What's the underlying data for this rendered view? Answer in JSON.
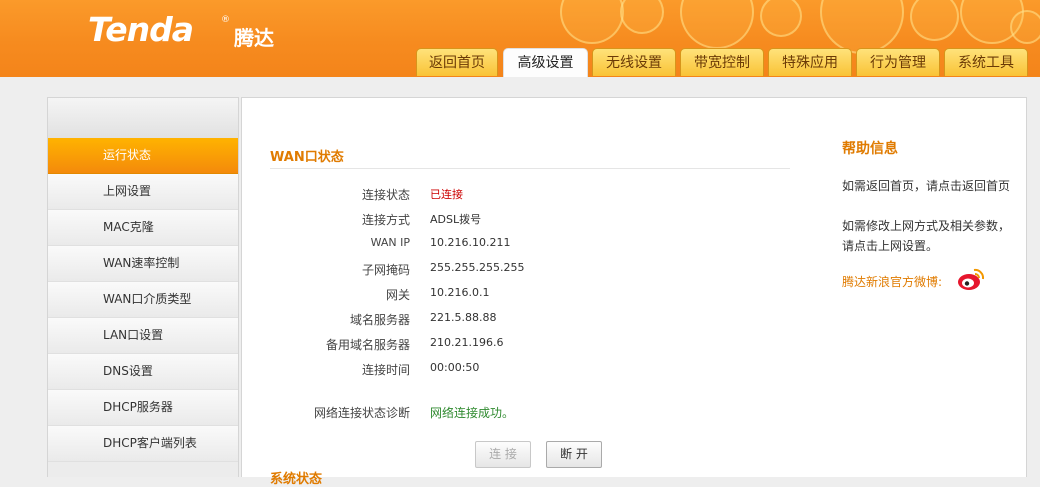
{
  "brand": {
    "logo_text": "Tenda",
    "reg_mark": "®",
    "cn_name": "腾达"
  },
  "tabs": [
    {
      "label": "返回首页"
    },
    {
      "label": "高级设置",
      "active": true
    },
    {
      "label": "无线设置"
    },
    {
      "label": "带宽控制"
    },
    {
      "label": "特殊应用"
    },
    {
      "label": "行为管理"
    },
    {
      "label": "系统工具"
    }
  ],
  "sidebar": {
    "items": [
      {
        "label": "运行状态",
        "active": true
      },
      {
        "label": "上网设置"
      },
      {
        "label": "MAC克隆"
      },
      {
        "label": "WAN速率控制"
      },
      {
        "label": "WAN口介质类型"
      },
      {
        "label": "LAN口设置"
      },
      {
        "label": "DNS设置"
      },
      {
        "label": "DHCP服务器"
      },
      {
        "label": "DHCP客户端列表"
      }
    ]
  },
  "wan_status": {
    "title": "WAN口状态",
    "rows": [
      {
        "label": "连接状态",
        "value": "已连接"
      },
      {
        "label": "连接方式",
        "value": "ADSL拨号"
      },
      {
        "label": "WAN IP",
        "value": "10.216.10.211"
      },
      {
        "label": "子网掩码",
        "value": "255.255.255.255"
      },
      {
        "label": "网关",
        "value": "10.216.0.1"
      },
      {
        "label": "域名服务器",
        "value": "221.5.88.88"
      },
      {
        "label": "备用域名服务器",
        "value": "210.21.196.6"
      },
      {
        "label": "连接时间",
        "value": "00:00:50"
      }
    ],
    "diagnosis_label": "网络连接状态诊断",
    "diagnosis_value": "网络连接成功。",
    "connect_button": "连 接",
    "disconnect_button": "断 开",
    "next_section_partial": "系统状态"
  },
  "help": {
    "title": "帮助信息",
    "text1": "如需返回首页，请点击返回首页",
    "text2": "如需修改上网方式及相关参数，请点击上网设置。",
    "weibo_label": "腾达新浪官方微博:"
  },
  "colors": {
    "header_orange": "#f68b1f",
    "accent_orange": "#e07b00",
    "status_red": "#cc0000",
    "status_green": "#2f8a2f"
  }
}
